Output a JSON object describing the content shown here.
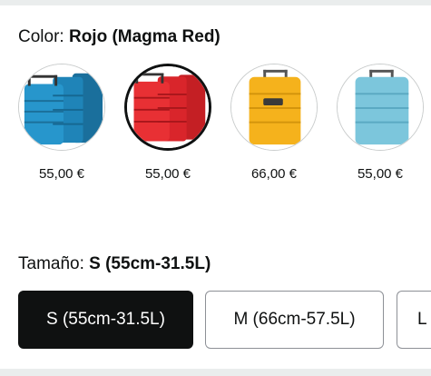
{
  "color_selector": {
    "label": "Color:",
    "selected_value": "Rojo (Magma Red)",
    "options": [
      {
        "icon": "teal-blue-luggage-set",
        "color": "#1f84b8",
        "price": "55,00 €",
        "selected": false
      },
      {
        "icon": "red-luggage-set",
        "color": "#e02a2e",
        "price": "55,00 €",
        "selected": true
      },
      {
        "icon": "yellow-suitcase",
        "color": "#f5b21c",
        "price": "66,00 €",
        "selected": false
      },
      {
        "icon": "light-blue-suitcase",
        "color": "#7cc6dc",
        "price": "55,00 €",
        "selected": false
      }
    ]
  },
  "size_selector": {
    "label": "Tamaño:",
    "selected_value": "S (55cm-31.5L)",
    "options": [
      {
        "label": "S (55cm-31.5L)",
        "selected": true
      },
      {
        "label": "M (66cm-57.5L)",
        "selected": false
      },
      {
        "label": "L",
        "selected": false
      }
    ]
  }
}
